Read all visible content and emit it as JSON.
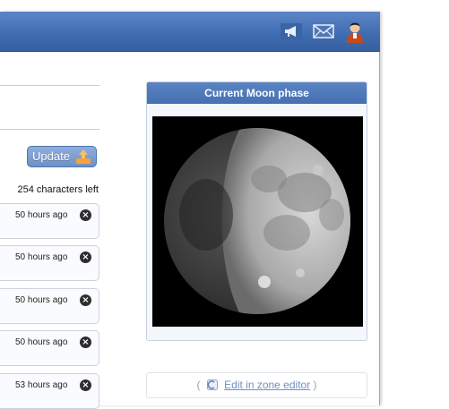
{
  "toolbar": {
    "update_label": "Update",
    "chars_left": "254 characters left"
  },
  "header_icons": [
    "megaphone-icon",
    "mail-icon",
    "user-icon"
  ],
  "comments": [
    {
      "time": "50 hours ago"
    },
    {
      "time": "50 hours ago"
    },
    {
      "time": "50 hours ago"
    },
    {
      "time": "50 hours ago"
    },
    {
      "time": "53 hours ago"
    }
  ],
  "moon_widget": {
    "title": "Current Moon phase"
  },
  "zone_editor": {
    "open_paren": "(",
    "link_label": "Edit in zone editor",
    "close_paren": ")"
  },
  "colors": {
    "header_blue": "#4170b3",
    "panel_title_blue": "#4f79bb",
    "link_blue": "#6e8fbf"
  }
}
